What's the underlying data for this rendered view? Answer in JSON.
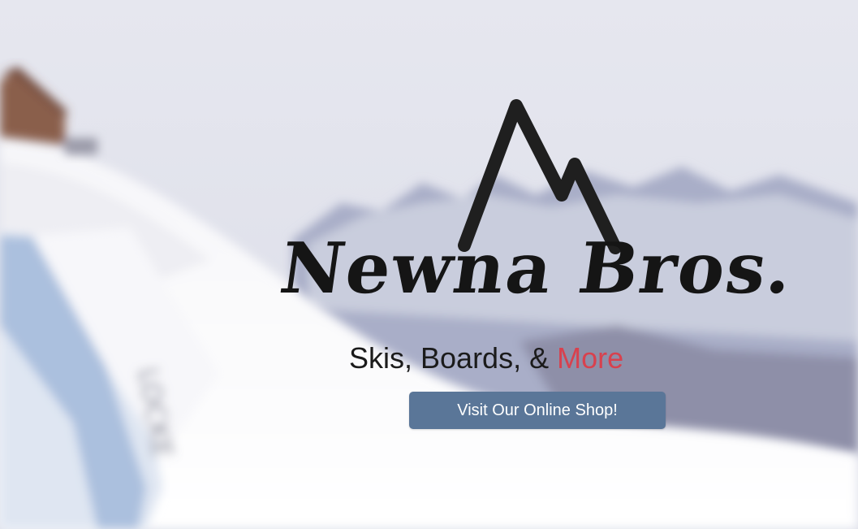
{
  "hero": {
    "brand_name": "Newna Bros.",
    "tagline_prefix": "Skis, Boards, &",
    "tagline_accent": "More",
    "cta_label": "Visit Our Online Shop!"
  },
  "colors": {
    "accent": "#d8414e",
    "cta_background": "#5a7698",
    "text_dark": "#1b1b1b"
  },
  "icons": {
    "logo": "mountain-icon"
  }
}
